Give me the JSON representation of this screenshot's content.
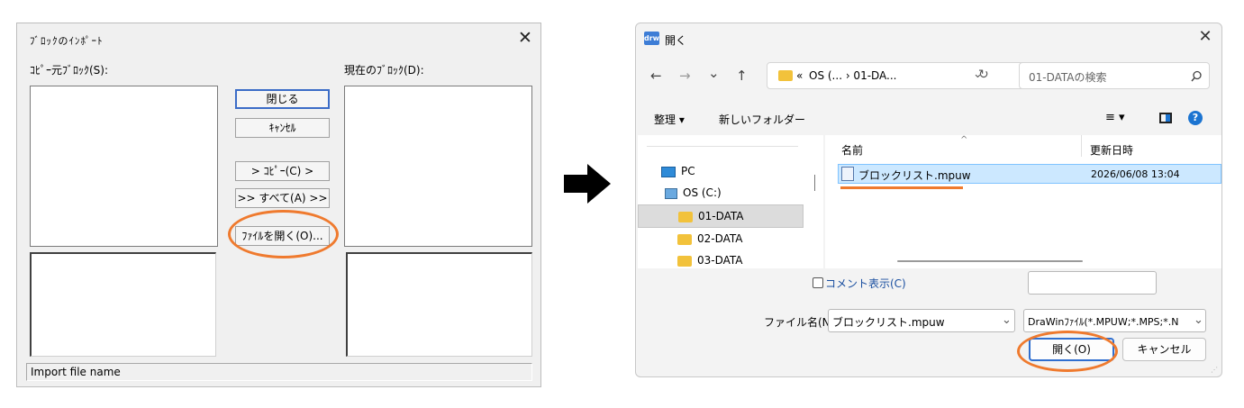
{
  "left_dialog": {
    "title": "ﾌﾞﾛｯｸのｲﾝﾎﾟｰﾄ",
    "close_glyph": "✕",
    "source_label": "ｺﾋﾟｰ元ﾌﾞﾛｯｸ(S):",
    "current_label": "現在のﾌﾞﾛｯｸ(D):",
    "buttons": {
      "close": "閉じる",
      "cancel": "ｷｬﾝｾﾙ",
      "copy": "> ｺﾋﾟｰ(C) >",
      "all": ">> すべて(A) >>",
      "open_file": "ﾌｧｲﾙを開く(O)..."
    },
    "status": "Import file name"
  },
  "right_dialog": {
    "app_icon": "drw",
    "title": "開く",
    "close_glyph": "✕",
    "nav": {
      "back": "←",
      "forward": "→",
      "recent": "⌄",
      "up": "↑"
    },
    "address": {
      "prefix": "«",
      "path": "OS (... › 01-DA...",
      "dropdown": "⌄",
      "refresh": "↻"
    },
    "search_placeholder": "01-DATAの検索",
    "toolbar": {
      "organize": "整理 ▾",
      "new_folder": "新しいフォルダー",
      "view": "≡ ▾",
      "help": "?"
    },
    "nav_tree": [
      {
        "label": "PC",
        "icon": "pc-icon"
      },
      {
        "label": "OS (C:)",
        "icon": "drive-icon"
      },
      {
        "label": "01-DATA",
        "icon": "folder-icon"
      },
      {
        "label": "02-DATA",
        "icon": "folder-icon"
      },
      {
        "label": "03-DATA",
        "icon": "folder-icon"
      }
    ],
    "columns": {
      "name": "名前",
      "modified": "更新日時"
    },
    "files": [
      {
        "name": "ブロックリスト.mpuw",
        "modified": "2026/06/08 13:04"
      }
    ],
    "comment_label": "コメント表示(C)",
    "filename_label": "ファイル名(N):",
    "filename_value": "ブロックリスト.mpuw",
    "filetype_value": "DraWinﾌｧｲﾙ(*.MPUW;*.MPS;*.N",
    "open_button": "開く(O)",
    "cancel_button": "キャンセル"
  }
}
